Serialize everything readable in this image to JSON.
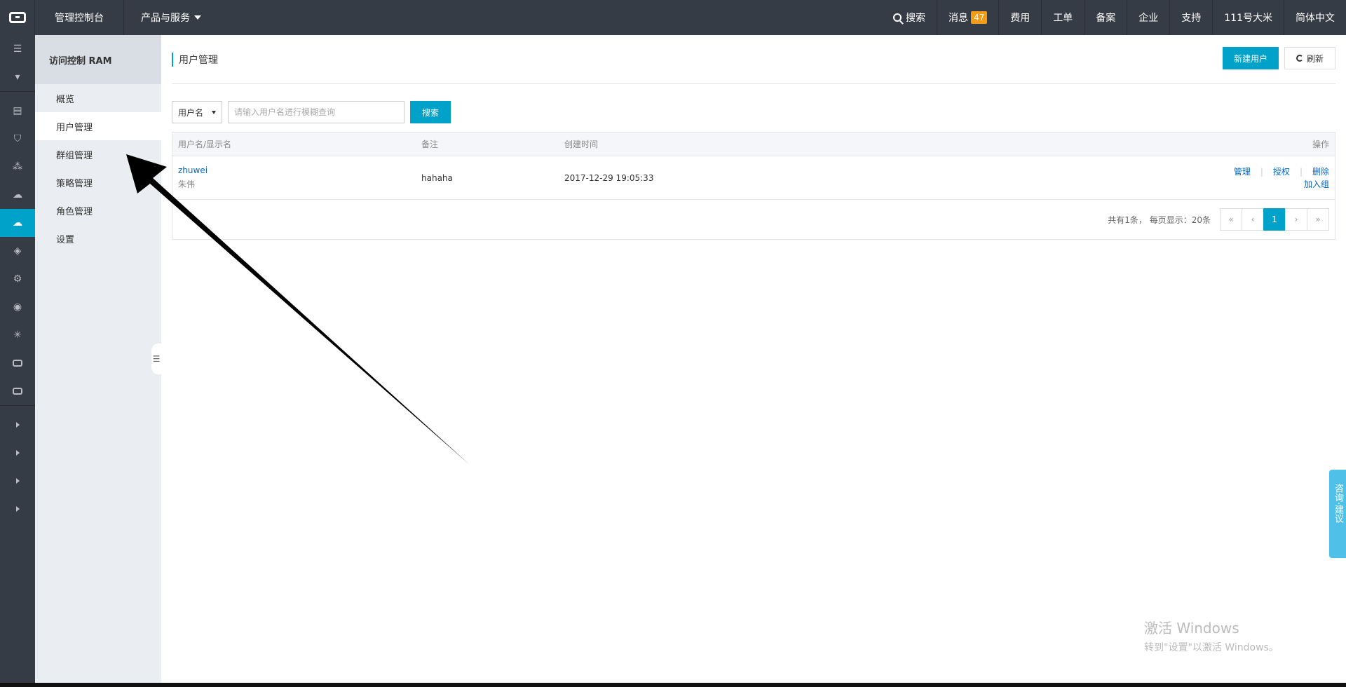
{
  "topbar": {
    "console": "管理控制台",
    "products": "产品与服务",
    "search": "搜索",
    "messages": "消息",
    "message_count": "47",
    "fees": "费用",
    "tickets": "工单",
    "filing": "备案",
    "enterprise": "企业",
    "support": "支持",
    "account": "111号大米",
    "language": "简体中文"
  },
  "subnav": {
    "title": "访问控制 RAM",
    "items": [
      "概览",
      "用户管理",
      "群组管理",
      "策略管理",
      "角色管理",
      "设置"
    ]
  },
  "page": {
    "title": "用户管理",
    "new_user": "新建用户",
    "refresh": "刷新"
  },
  "filter": {
    "select_value": "用户名",
    "placeholder": "请输入用户名进行模糊查询",
    "search_button": "搜索"
  },
  "table": {
    "headers": [
      "用户名/显示名",
      "备注",
      "创建时间",
      "操作"
    ],
    "rows": [
      {
        "username": "zhuwei",
        "display_name": "朱伟",
        "note": "hahaha",
        "created": "2017-12-29 19:05:33",
        "actions": [
          "管理",
          "授权",
          "删除",
          "加入组"
        ]
      }
    ]
  },
  "pager": {
    "summary": "共有1条， 每页显示：20条",
    "first": "«",
    "prev": "‹",
    "current": "1",
    "next": "›",
    "last": "»"
  },
  "watermark": {
    "line1": "激活 Windows",
    "line2": "转到\"设置\"以激活 Windows。"
  },
  "consult": "咨询·建议",
  "colors": {
    "topbar_bg": "#363c45",
    "accent": "#00a2ca",
    "badge": "#f59c14",
    "subnav_bg": "#eaedf1"
  }
}
